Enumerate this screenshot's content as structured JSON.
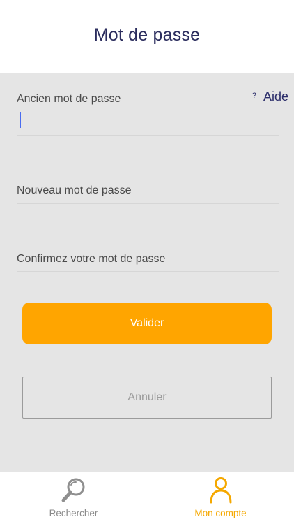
{
  "header": {
    "title": "Mot de passe"
  },
  "help": {
    "icon": "question-icon",
    "icon_glyph": "?",
    "label": "Aide"
  },
  "form": {
    "old_password": {
      "label": "Ancien mot de passe",
      "value": ""
    },
    "new_password": {
      "label": "Nouveau mot de passe",
      "value": ""
    },
    "confirm_password": {
      "label": "Confirmez votre mot de passe",
      "value": ""
    }
  },
  "buttons": {
    "submit_label": "Valider",
    "cancel_label": "Annuler"
  },
  "tabbar": {
    "items": [
      {
        "label": "Rechercher",
        "icon": "search-icon",
        "active": false
      },
      {
        "label": "Mon compte",
        "icon": "user-icon",
        "active": true
      }
    ]
  },
  "colors": {
    "accent": "#ffa500",
    "title": "#2b2d5e",
    "background": "#e5e5e5",
    "inactive": "#8a8a8a"
  }
}
